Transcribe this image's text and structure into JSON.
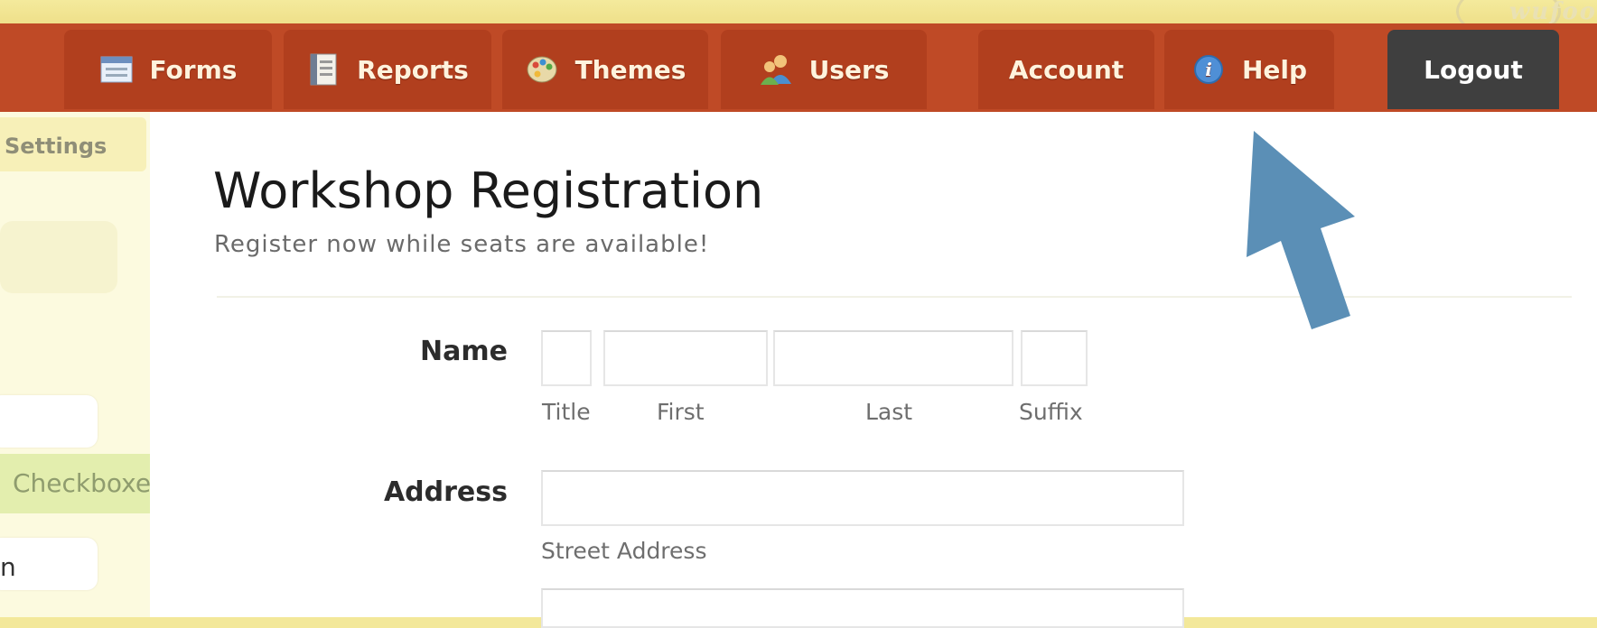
{
  "nav": {
    "tabs": [
      {
        "label": "Forms",
        "icon": "forms-icon"
      },
      {
        "label": "Reports",
        "icon": "reports-icon"
      },
      {
        "label": "Themes",
        "icon": "themes-icon"
      },
      {
        "label": "Users",
        "icon": "users-icon"
      }
    ],
    "account_label": "Account",
    "help_label": "Help",
    "logout_label": "Logout"
  },
  "sidebar": {
    "settings_label": "Settings",
    "checkboxes_label": "Checkboxes",
    "cut_text": "n"
  },
  "form": {
    "title": "Workshop Registration",
    "description": "Register now while seats are available!",
    "name_label": "Name",
    "name_sublabels": {
      "title": "Title",
      "first": "First",
      "last": "Last",
      "suffix": "Suffix"
    },
    "address_label": "Address",
    "street_sublabel": "Street Address"
  },
  "colors": {
    "nav_bar": "#bf4a26",
    "nav_tab": "#b13f1e",
    "logout_tab": "#3f3f3f",
    "sidebar_bg": "#fcfadf",
    "arrow": "#5b8fb6"
  }
}
